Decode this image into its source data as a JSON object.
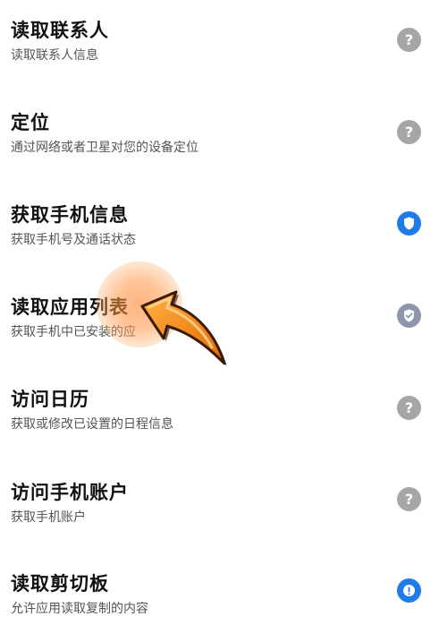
{
  "permissions": [
    {
      "title": "读取联系人",
      "description": "读取联系人信息",
      "status": "ask",
      "status_icon": "question-icon",
      "color": "#a6a6a6"
    },
    {
      "title": "定位",
      "description": "通过网络或者卫星对您的设备定位",
      "status": "ask",
      "status_icon": "question-icon",
      "color": "#a6a6a6"
    },
    {
      "title": "获取手机信息",
      "description": "获取手机号及通话状态",
      "status": "allowed",
      "status_icon": "shield-icon",
      "color": "#1e7be8"
    },
    {
      "title": "读取应用列表",
      "description": "获取手机中已安装的应",
      "status": "allowed-dim",
      "status_icon": "shield-check-icon",
      "color": "#8e96ae"
    },
    {
      "title": "访问日历",
      "description": "获取或修改已设置的日程信息",
      "status": "ask",
      "status_icon": "question-icon",
      "color": "#a6a6a6"
    },
    {
      "title": "访问手机账户",
      "description": "获取手机账户",
      "status": "ask",
      "status_icon": "question-icon",
      "color": "#a6a6a6"
    },
    {
      "title": "读取剪切板",
      "description": "允许应用读取复制的内容",
      "status": "allowed",
      "status_icon": "info-icon",
      "color": "#1e7be8"
    }
  ],
  "overlay": {
    "pointer_icon": "orange-arrow-pointer-icon",
    "highlight_color": "#ff8c3c",
    "arrow_color": "#f28a1e"
  }
}
